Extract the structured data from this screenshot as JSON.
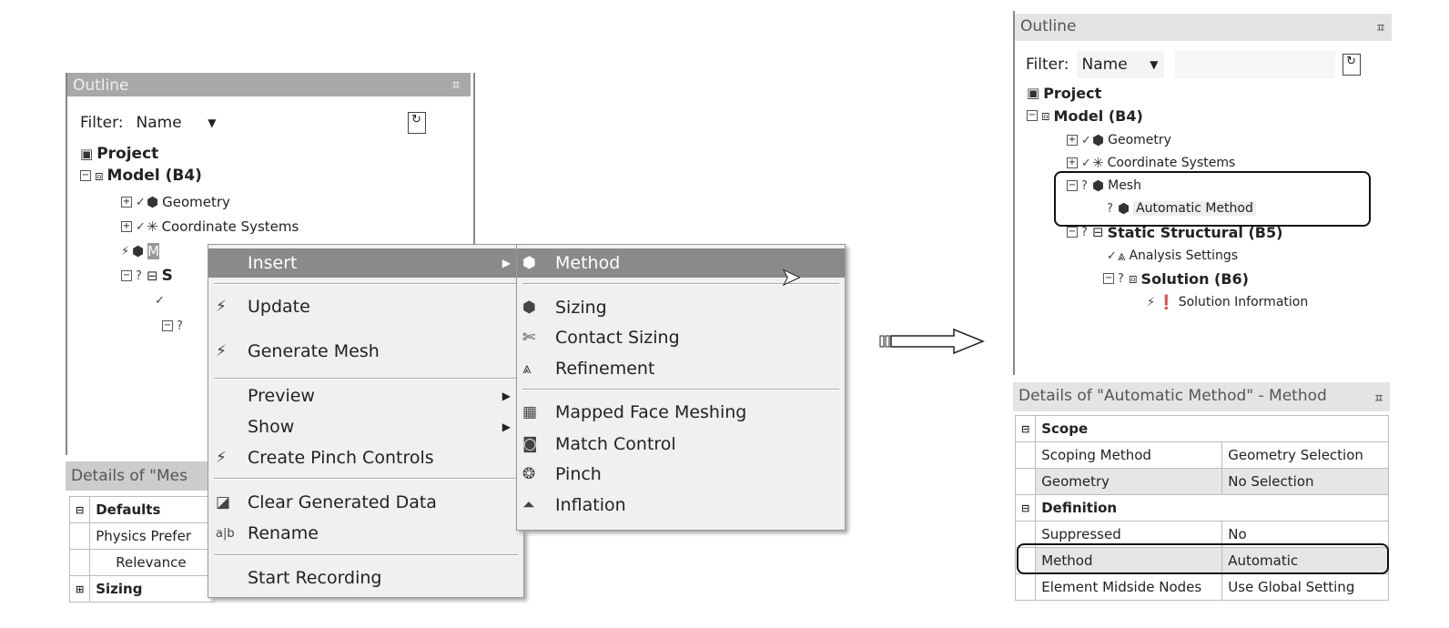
{
  "left_outline": {
    "title": "Outline",
    "pin_icon": "pin-icon",
    "filter_label": "Filter:",
    "filter_value": "Name",
    "search_value": "",
    "tree": [
      {
        "label": "Project",
        "bold": true,
        "icon": "project-icon"
      },
      {
        "label": "Model (B4)",
        "bold": true,
        "icon": "model-icon"
      },
      {
        "label": "Geometry",
        "status": "✓",
        "icon": "geometry-icon"
      },
      {
        "label": "Coordinate Systems",
        "status": "✓",
        "icon": "coordinate-systems-icon"
      },
      {
        "label": "M",
        "status": "⚡",
        "icon": "mesh-icon"
      },
      {
        "label": "S",
        "bold": true,
        "status": "?",
        "icon": "static-structural-icon"
      },
      {
        "label": "",
        "status": "✓"
      },
      {
        "label": "",
        "status": "?"
      }
    ],
    "details_title": "Details of \"Mes",
    "details_rows": [
      {
        "label": "Defaults",
        "group": true
      },
      {
        "label": "Physics Prefer"
      },
      {
        "label": "Relevance"
      },
      {
        "label": "Sizing",
        "group": true
      }
    ]
  },
  "context_menu": {
    "items": [
      "Insert",
      "Update",
      "Generate Mesh",
      "Preview",
      "Show",
      "Create Pinch Controls",
      "Clear Generated Data",
      "Rename",
      "Start Recording"
    ]
  },
  "insert_submenu": {
    "items": [
      "Method",
      "Sizing",
      "Contact Sizing",
      "Refinement",
      "Mapped Face Meshing",
      "Match Control",
      "Pinch",
      "Inflation"
    ]
  },
  "right_outline": {
    "title": "Outline",
    "filter_label": "Filter:",
    "filter_value": "Name",
    "search_value": "",
    "tree": [
      "Project",
      "Model (B4)",
      "Geometry",
      "Coordinate Systems",
      "Mesh",
      "Automatic Method",
      "Static Structural (B5)",
      "Analysis Settings",
      "Solution (B6)",
      "Solution Information"
    ],
    "details_title": "Details of \"Automatic Method\" - Method",
    "details": [
      {
        "label": "Scope",
        "group": true
      },
      {
        "label": "Scoping Method",
        "value": "Geometry Selection"
      },
      {
        "label": "Geometry",
        "value": "No Selection",
        "shaded": true
      },
      {
        "label": "Definition",
        "group": true
      },
      {
        "label": "Suppressed",
        "value": "No"
      },
      {
        "label": "Method",
        "value": "Automatic",
        "shaded": true
      },
      {
        "label": "Element Midside Nodes",
        "value": "Use Global Setting"
      }
    ]
  },
  "colors": {
    "highlight": "#8a8a8a",
    "menu_bg": "#f0f0f0",
    "header_gray": "#a8a8a8"
  }
}
